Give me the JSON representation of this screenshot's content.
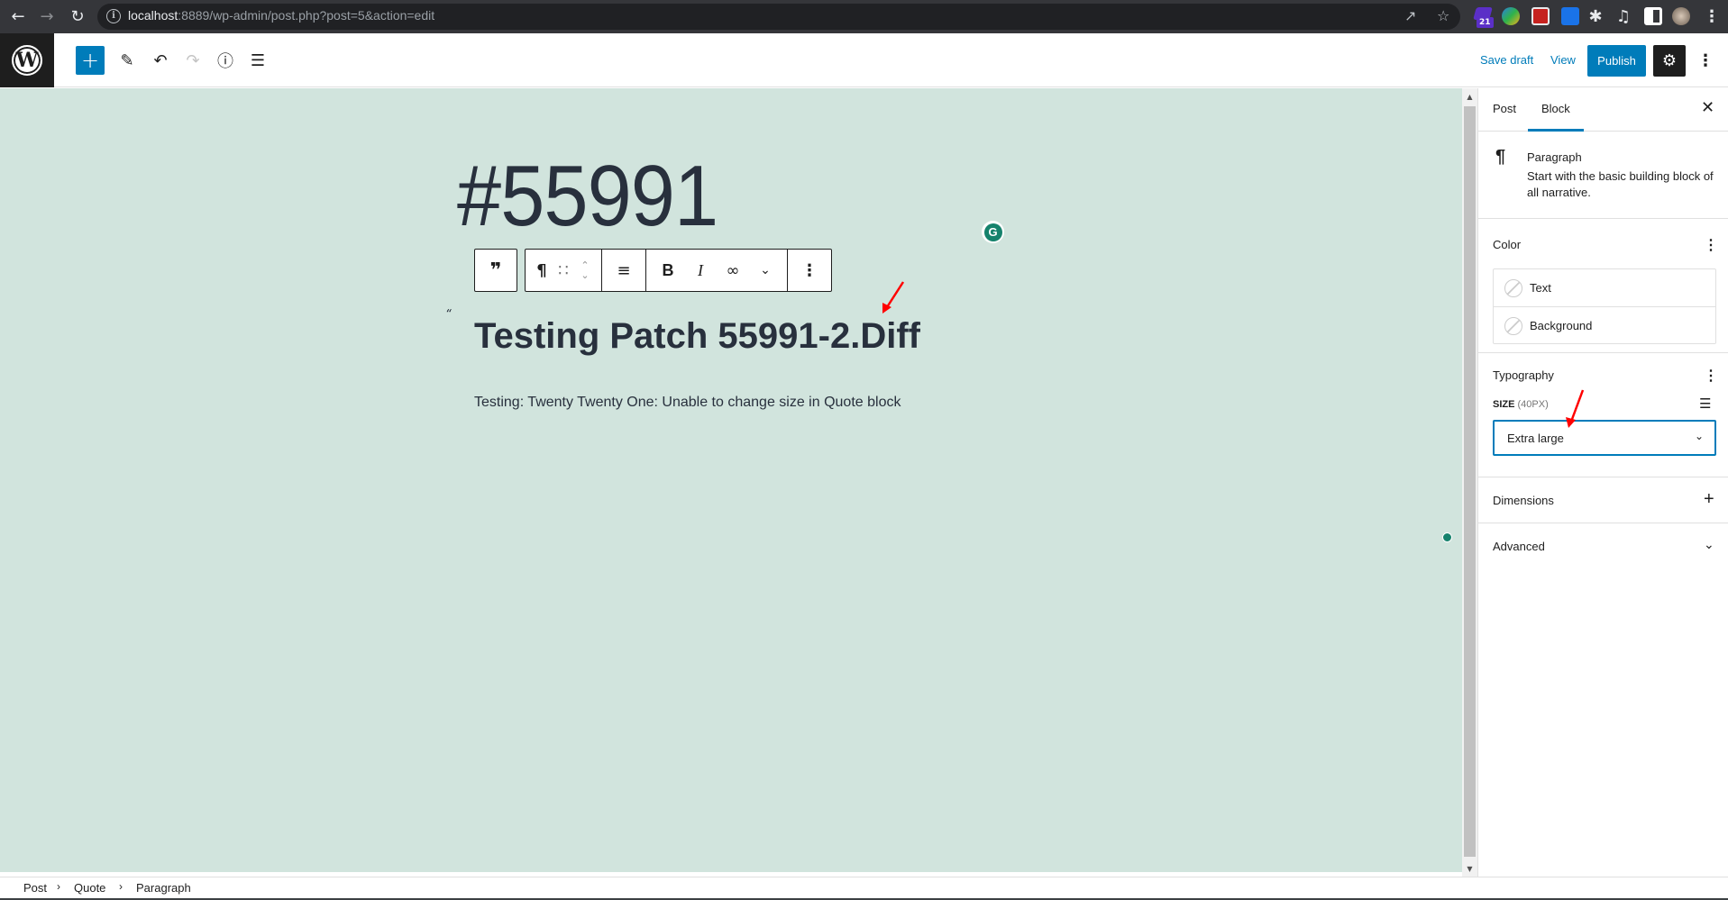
{
  "browser": {
    "url_host": "localhost",
    "url_rest": ":8889/wp-admin/post.php?post=5&action=edit",
    "extension_badge": "21",
    "icons": [
      "back-icon",
      "forward-icon",
      "reload-icon",
      "info-icon",
      "share-icon",
      "star-icon",
      "extension-icon",
      "puzzle-icon",
      "media-icon",
      "sidepanel-icon",
      "profile-avatar",
      "menu-icon"
    ]
  },
  "header": {
    "save_draft": "Save draft",
    "view": "View",
    "publish": "Publish"
  },
  "editor": {
    "post_title": "#55991",
    "quote_mark": "“",
    "quote_heading": "Testing Patch 55991-2.Diff",
    "quote_paragraph": "Testing: Twenty Twenty One: Unable to change size in Quote block",
    "toolbar": {
      "parent": "❞",
      "block_type": "¶",
      "drag": "∷",
      "align": "≡",
      "bold": "B",
      "italic": "I",
      "link": "∞",
      "more": "⌄",
      "options": "⋮"
    }
  },
  "sidebar": {
    "tabs": [
      {
        "label": "Post",
        "active": false
      },
      {
        "label": "Block",
        "active": true
      }
    ],
    "block_card": {
      "title": "Paragraph",
      "description": "Start with the basic building block of all narrative."
    },
    "color": {
      "title": "Color",
      "items": [
        {
          "label": "Text"
        },
        {
          "label": "Background"
        }
      ]
    },
    "typography": {
      "title": "Typography",
      "size_label": "Size",
      "size_value": "(40px)",
      "selected": "Extra large"
    },
    "dimensions": {
      "title": "Dimensions"
    },
    "advanced": {
      "title": "Advanced"
    }
  },
  "breadcrumbs": [
    "Post",
    "Quote",
    "Paragraph"
  ],
  "colors": {
    "accent": "#007cba",
    "canvas": "#d1e4dd",
    "annotation": "#ff0000",
    "grammarly": "#15826c"
  }
}
